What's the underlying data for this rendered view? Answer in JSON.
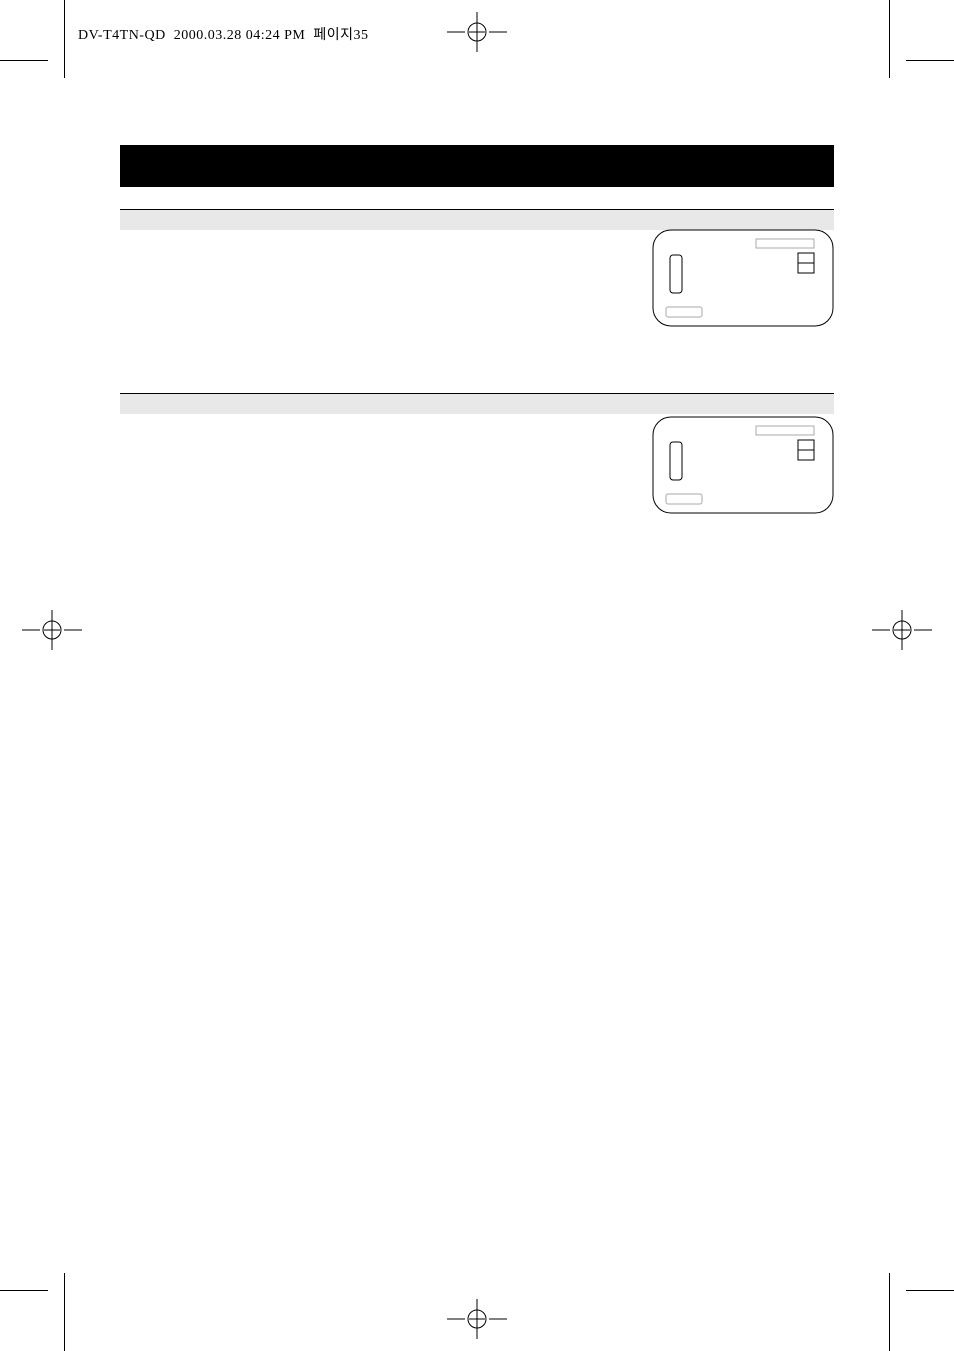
{
  "header": {
    "doc_id": "DV-T4TN-QD",
    "timestamp": "2000.03.28 04:24 PM",
    "page_label": "페이지35"
  }
}
